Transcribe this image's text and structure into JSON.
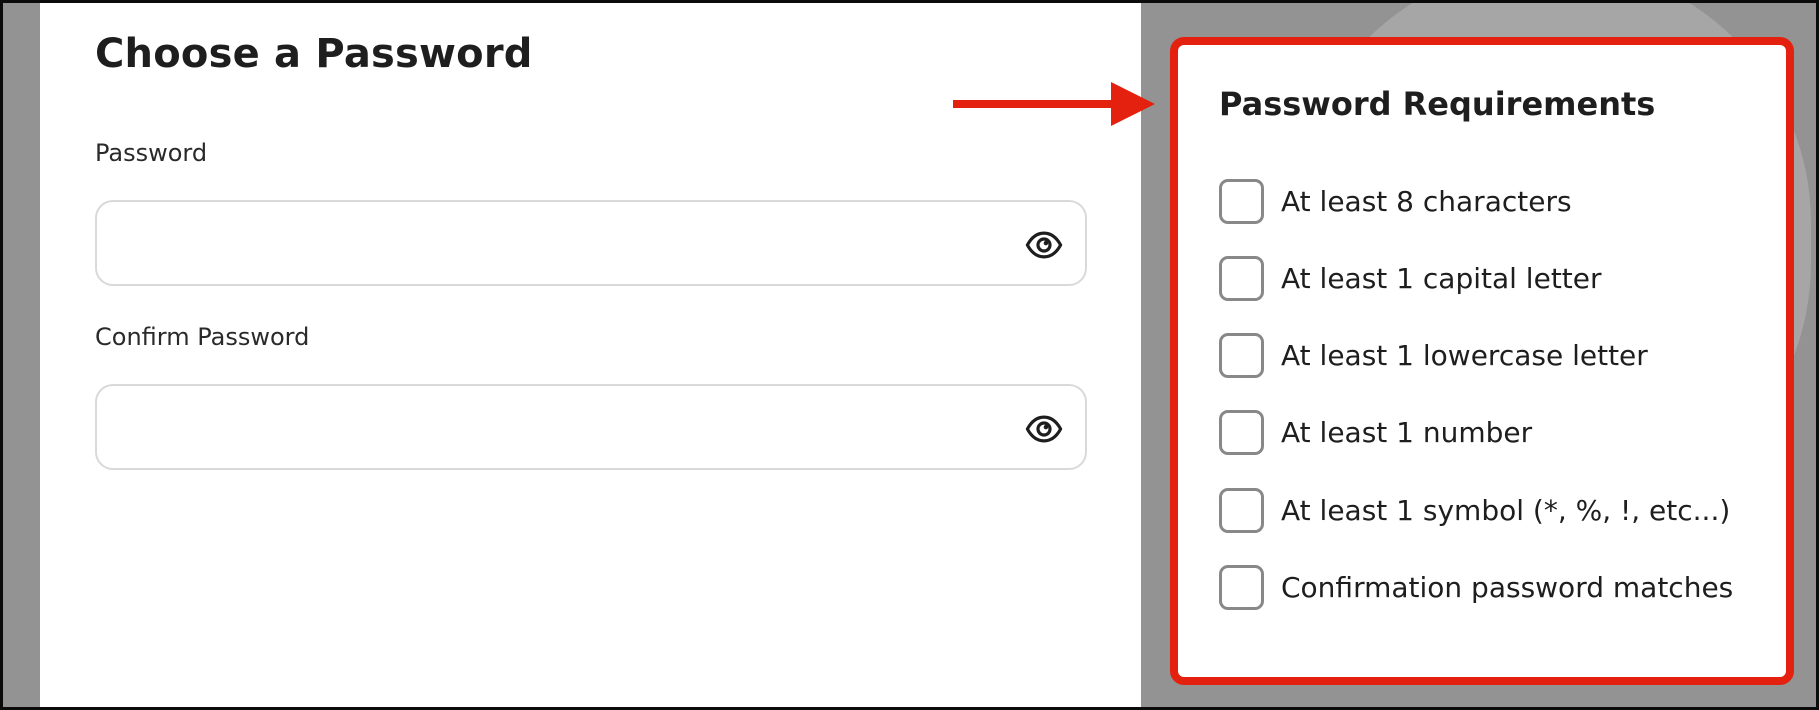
{
  "form": {
    "title": "Choose a Password",
    "password": {
      "label": "Password",
      "value": "",
      "placeholder": ""
    },
    "confirm_password": {
      "label": "Confirm Password",
      "value": "",
      "placeholder": ""
    }
  },
  "requirements": {
    "title": "Password Requirements",
    "items": [
      {
        "label": "At least 8 characters",
        "checked": false
      },
      {
        "label": "At least 1 capital letter",
        "checked": false
      },
      {
        "label": "At least 1 lowercase letter",
        "checked": false
      },
      {
        "label": "At least 1 number",
        "checked": false
      },
      {
        "label": "At least 1 symbol (*, %, !, etc...)",
        "checked": false
      },
      {
        "label": "Confirmation password matches",
        "checked": false
      }
    ]
  },
  "colors": {
    "highlight": "#e3210e",
    "overlay": "#939393",
    "checkbox_border": "#888888",
    "field_border": "#d9d9d9"
  },
  "icons": {
    "visibility_toggle": "eye-icon",
    "annotation_arrow": "arrow-right-icon"
  }
}
